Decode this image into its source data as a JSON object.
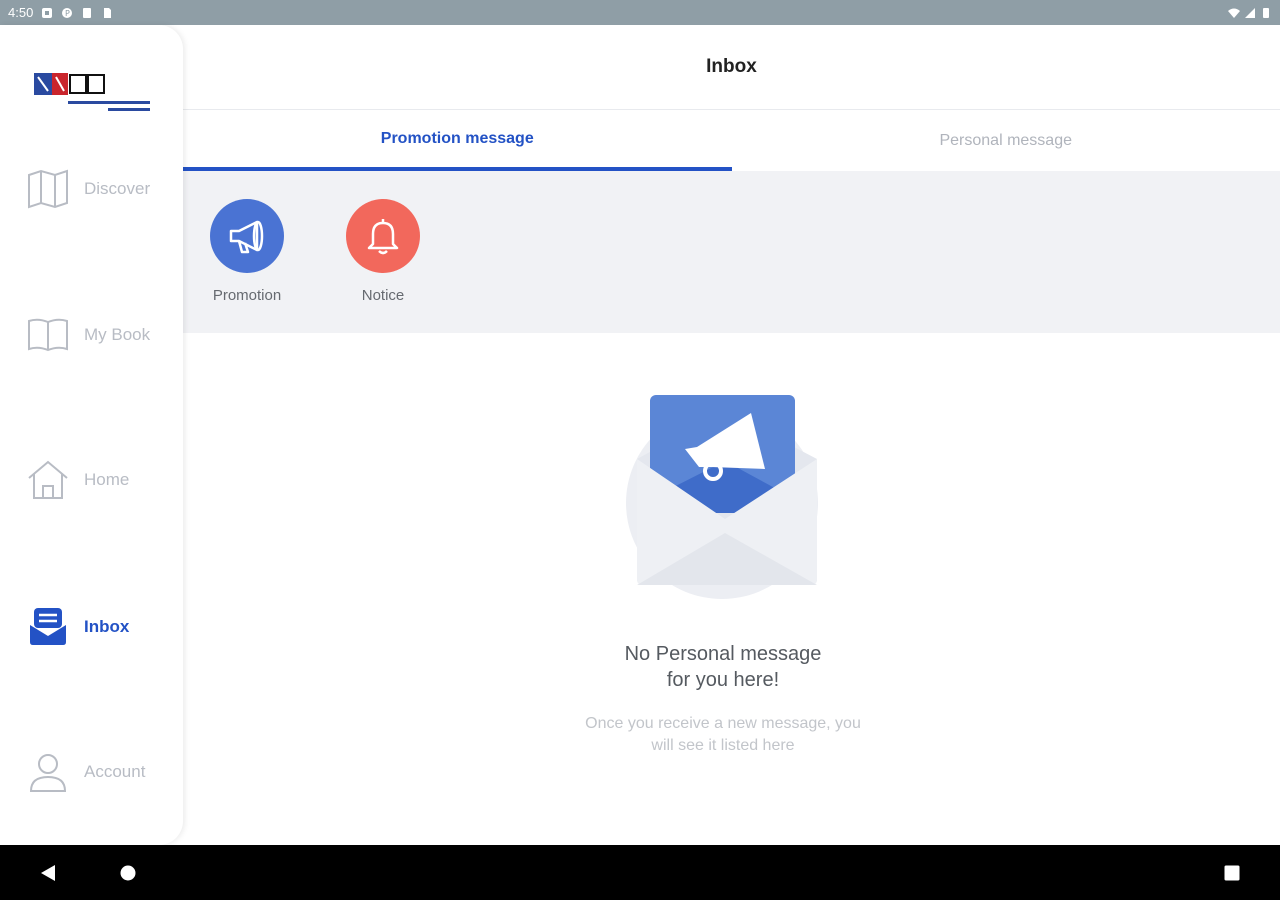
{
  "status_bar": {
    "time": "4:50"
  },
  "sidebar": {
    "items": [
      {
        "label": "Discover",
        "icon": "map-icon"
      },
      {
        "label": "My Book",
        "icon": "book-icon"
      },
      {
        "label": "Home",
        "icon": "home-icon"
      },
      {
        "label": "Inbox",
        "icon": "inbox-icon"
      },
      {
        "label": "Account",
        "icon": "user-icon"
      }
    ]
  },
  "header": {
    "title": "Inbox"
  },
  "tabs": [
    {
      "label": "Promotion message"
    },
    {
      "label": "Personal message"
    }
  ],
  "categories": [
    {
      "label": "Promotion",
      "icon": "megaphone-icon",
      "color": "#4a73d3"
    },
    {
      "label": "Notice",
      "icon": "bell-icon",
      "color": "#f2685c"
    }
  ],
  "empty_state": {
    "title_line1": "No Personal message",
    "title_line2": "for you here!",
    "subtitle_line1": "Once you receive a new message, you",
    "subtitle_line2": "will see it listed here"
  },
  "colors": {
    "accent": "#2352c5",
    "statusbar": "#8f9ea6"
  }
}
